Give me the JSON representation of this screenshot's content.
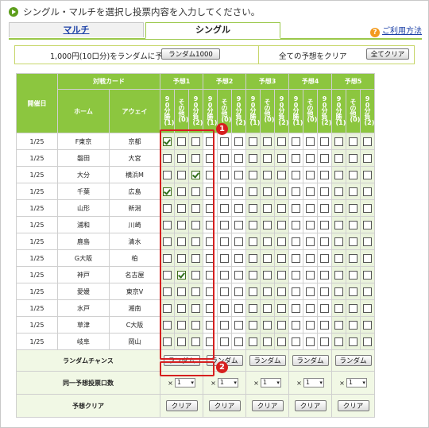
{
  "header": {
    "text": "シングル・マルチを選択し投票内容を入力してください。"
  },
  "tabs": [
    {
      "label": "マルチ"
    },
    {
      "label": "シングル"
    }
  ],
  "help": {
    "label": "ご利用方法",
    "icon": "help-icon"
  },
  "random_bar": {
    "random_text": "1,000円(10口分)をランダムに予想",
    "random_button": "ランダム1000",
    "clear_text": "全ての予想をクリア",
    "clear_button": "全てクリア"
  },
  "grid": {
    "header_card": "対戦カード",
    "header_date": "開催日",
    "header_home": "ホーム",
    "header_away": "アウェイ",
    "predictions": [
      "予想1",
      "予想2",
      "予想3",
      "予想4",
      "予想5"
    ],
    "sub_labels": [
      "90分勝(1)",
      "その他(0)",
      "90分負(2)"
    ],
    "matches": [
      {
        "date": "1/25",
        "home": "F東京",
        "away": "京都",
        "pick": "1"
      },
      {
        "date": "1/25",
        "home": "磐田",
        "away": "大宮",
        "pick": ""
      },
      {
        "date": "1/25",
        "home": "大分",
        "away": "横浜M",
        "pick": "2"
      },
      {
        "date": "1/25",
        "home": "千葉",
        "away": "広島",
        "pick": "1"
      },
      {
        "date": "1/25",
        "home": "山形",
        "away": "新潟",
        "pick": ""
      },
      {
        "date": "1/25",
        "home": "浦和",
        "away": "川崎",
        "pick": ""
      },
      {
        "date": "1/25",
        "home": "鹿島",
        "away": "清水",
        "pick": ""
      },
      {
        "date": "1/25",
        "home": "G大阪",
        "away": "柏",
        "pick": ""
      },
      {
        "date": "1/25",
        "home": "神戸",
        "away": "名古屋",
        "pick": "0"
      },
      {
        "date": "1/25",
        "home": "愛媛",
        "away": "東京V",
        "pick": ""
      },
      {
        "date": "1/25",
        "home": "水戸",
        "away": "湘南",
        "pick": ""
      },
      {
        "date": "1/25",
        "home": "草津",
        "away": "C大阪",
        "pick": ""
      },
      {
        "date": "1/25",
        "home": "岐阜",
        "away": "岡山",
        "pick": ""
      }
    ],
    "random_chance_label": "ランダムチャンス",
    "random_button": "ランダム",
    "units_label": "同一予想投票口数",
    "units_prefix": "×",
    "units_value": "1",
    "clear_label": "予想クリア",
    "clear_button": "クリア"
  },
  "annotations": [
    "1",
    "2"
  ]
}
